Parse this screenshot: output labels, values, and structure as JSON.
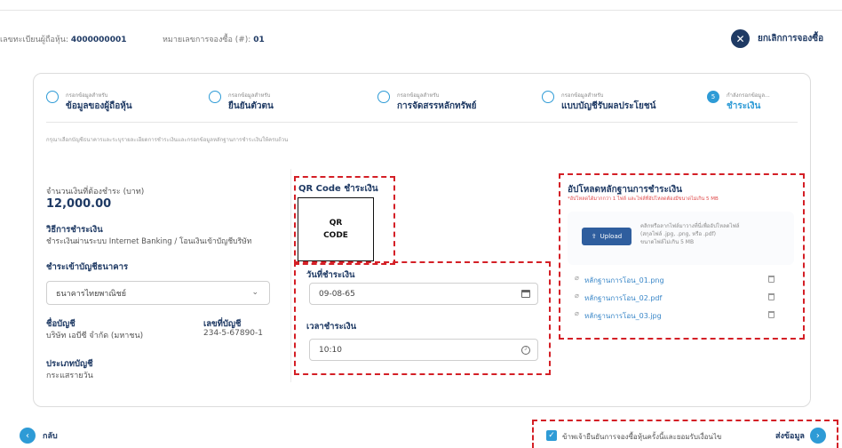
{
  "header": {
    "reg_label": "เลขทะเบียนผู้ถือหุ้น:",
    "reg_value": "4000000001",
    "order_label": "หมายเลขการจองซื้อ (#):",
    "order_value": "01",
    "cancel_label": "ยกเลิกการจองซื้อ"
  },
  "steps": [
    {
      "small": "กรอกข้อมูลสำหรับ",
      "label": "ข้อมูลของผู้ถือหุ้น"
    },
    {
      "small": "กรอกข้อมูลสำหรับ",
      "label": "ยืนยันตัวตน"
    },
    {
      "small": "กรอกข้อมูลสำหรับ",
      "label": "การจัดสรรหลักทรัพย์"
    },
    {
      "small": "กรอกข้อมูลสำหรับ",
      "label": "แบบบัญชีรับผลประโยชน์"
    },
    {
      "small": "กำลังกรอกข้อมูล...",
      "label": "ชำระเงิน",
      "number": "5"
    }
  ],
  "instruction": "กรุณาเลือกบัญชีธนาคารและระบุรายละเอียดการชำระเงินและกรอกข้อมูลหลักฐานการชำระเงินให้ครบถ้วน",
  "left": {
    "amount_label": "จำนวนเงินที่ต้องชำระ (บาท)",
    "amount_value": "12,000.00",
    "method_label": "วิธีการชำระเงิน",
    "method_value": "ชำระเงินผ่านระบบ Internet Banking / โอนเงินเข้าบัญชีบริษัท",
    "bank_label": "ชำระเข้าบัญชีธนาคาร",
    "bank_value": "ธนาคารไทยพาณิชย์",
    "account_name_label": "ชื่อบัญชี",
    "account_name_value": "บริษัท เอบีซี จำกัด (มหาชน)",
    "account_no_label": "เลขที่บัญชี",
    "account_no_value": "234-5-67890-1",
    "account_type_label": "ประเภทบัญชี",
    "account_type_value": "กระแสรายวัน"
  },
  "middle": {
    "qr_title": "QR Code ชำระเงิน",
    "qr_text_1": "QR",
    "qr_text_2": "CODE",
    "date_label": "วันที่ชำระเงิน",
    "date_value": "09-08-65",
    "time_label": "เวลาชำระเงิน",
    "time_value": "10:10"
  },
  "upload": {
    "title": "อัปโหลดหลักฐานการชำระเงิน",
    "note": "*อัปโหลดได้มากกว่า 1 ไฟล์ และไฟล์ที่อัปโหลดต้องมีขนาดไม่เกิน 5 MB",
    "button": "Upload",
    "hint_1": "คลิกหรือลากไฟล์มาวางที่นี่เพื่ออัปโหลดไฟล์",
    "hint_2": "(สกุลไฟล์ .jpg, .png, หรือ .pdf)",
    "hint_3": "ขนาดไฟล์ไม่เกิน 5 MB",
    "files": [
      "หลักฐานการโอน_01.png",
      "หลักฐานการโอน_02.pdf",
      "หลักฐานการโอน_03.jpg"
    ]
  },
  "footer": {
    "back_label": "กลับ",
    "consent_label": "ข้าพเจ้ายืนยันการจองซื้อหุ้นครั้งนี้และยอมรับเงื่อนไข",
    "submit_label": "ส่งข้อมูล"
  },
  "colors": {
    "navy": "#1f3a64",
    "accent": "#2e9bd6",
    "highlight": "#d41f26"
  }
}
